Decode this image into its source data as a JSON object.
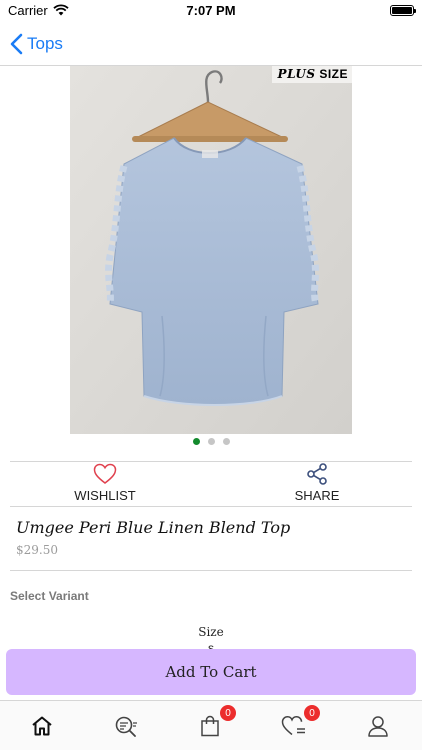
{
  "status_bar": {
    "carrier": "Carrier",
    "time": "7:07 PM"
  },
  "nav": {
    "back_label": "Tops"
  },
  "product": {
    "badge_plus": "PLUS",
    "badge_size": "SIZE",
    "name": "Umgee Peri Blue Linen Blend Top",
    "price": "$29.50",
    "image_count": 3,
    "active_image_index": 0,
    "garment_color": "#a9bdd8"
  },
  "actions": {
    "wishlist_label": "WISHLIST",
    "share_label": "SHARE"
  },
  "variant": {
    "heading": "Select Variant",
    "size_label": "Size",
    "size_value": "s"
  },
  "cart": {
    "button_label": "Add To Cart",
    "button_color": "#d6b7ff"
  },
  "tab_bar": {
    "items": [
      {
        "name": "home",
        "icon": "home-icon"
      },
      {
        "name": "search",
        "icon": "search-icon"
      },
      {
        "name": "cart",
        "icon": "shopping-bag-icon",
        "badge": "0"
      },
      {
        "name": "wishlist",
        "icon": "heart-icon",
        "badge": "0"
      },
      {
        "name": "profile",
        "icon": "user-icon"
      }
    ]
  },
  "colors": {
    "accent": "#1a7cf5",
    "dot_active": "#138a2d",
    "badge": "#ec2d2d"
  }
}
